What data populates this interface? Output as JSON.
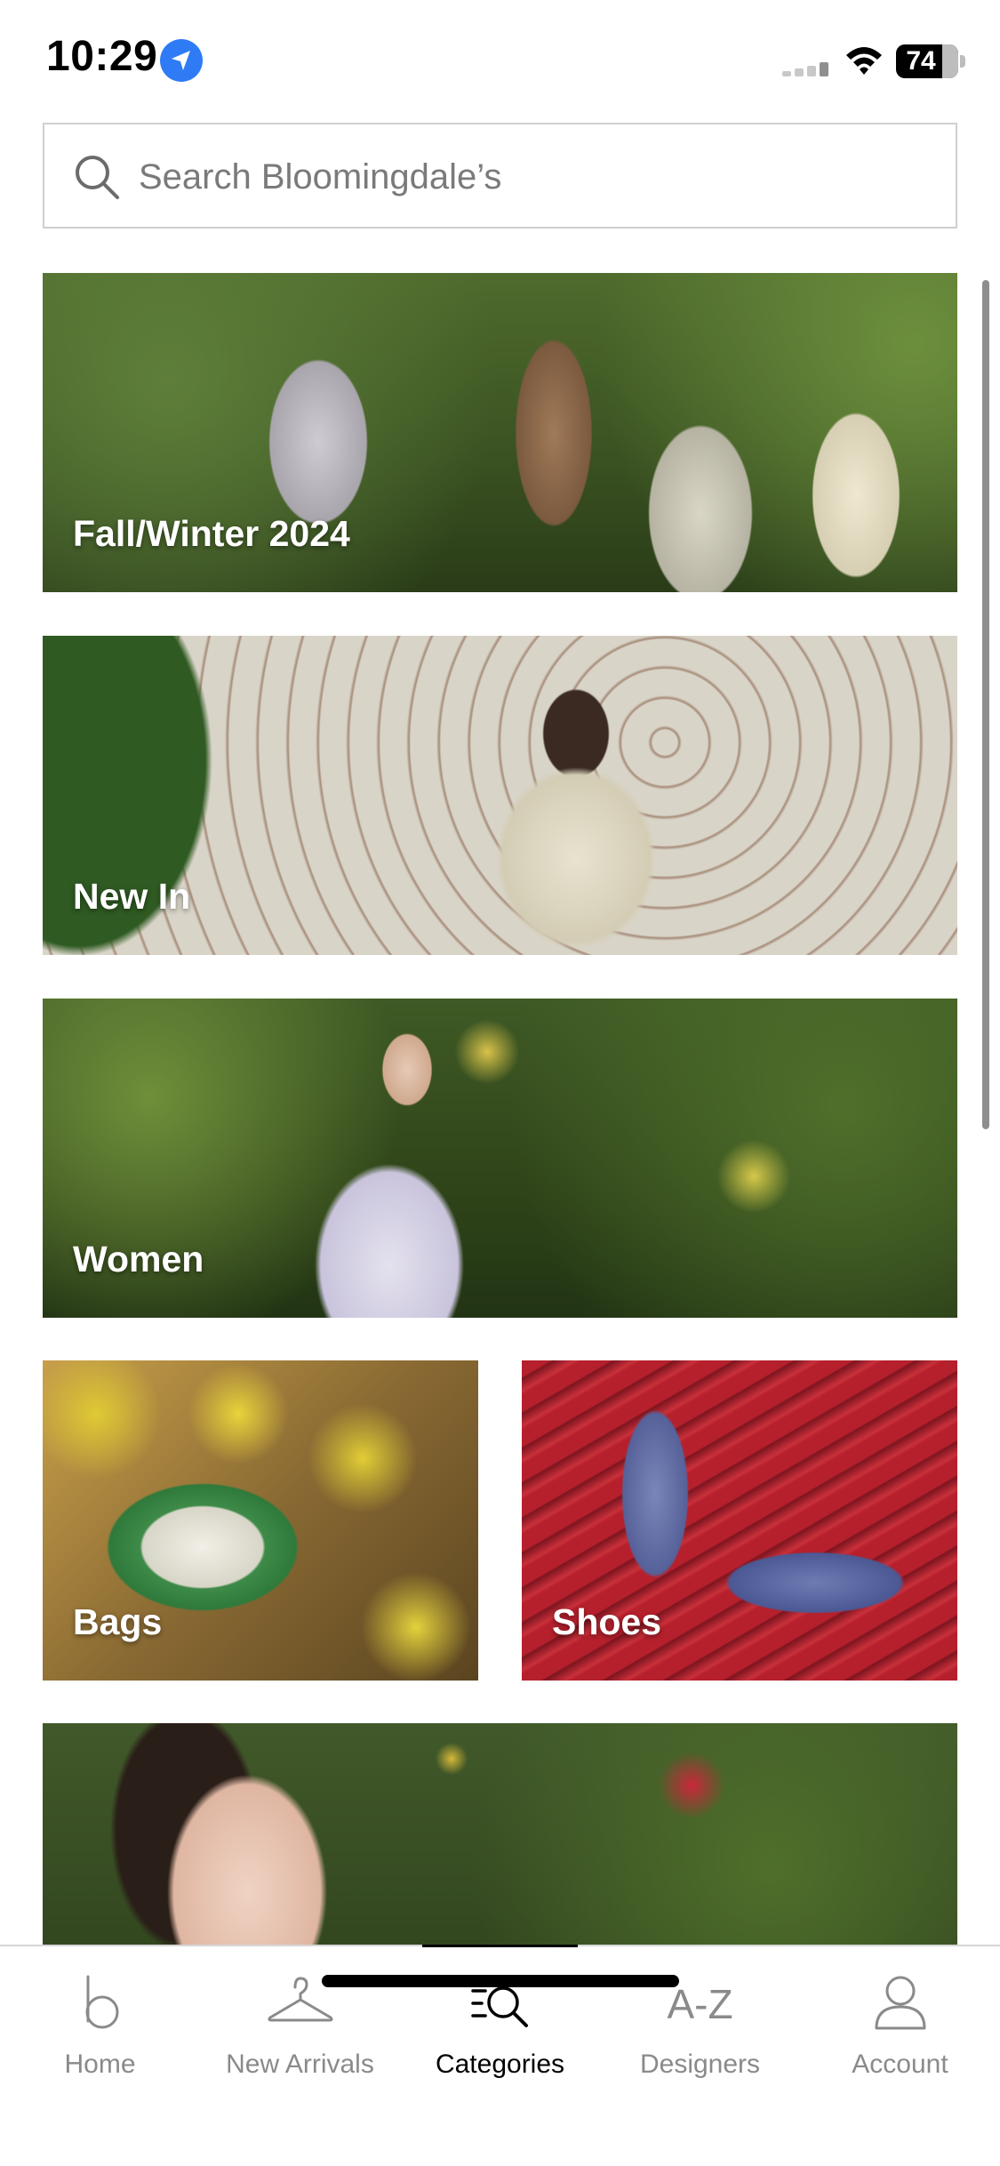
{
  "status_bar": {
    "time": "10:29",
    "battery_level": "74",
    "icons": [
      "location-arrow-icon",
      "cellular-signal-icon",
      "wifi-icon",
      "battery-icon"
    ]
  },
  "search": {
    "placeholder": "Search Bloomingdale’s",
    "value": "",
    "icon": "search-icon"
  },
  "categories": [
    {
      "label": "Fall/Winter 2024"
    },
    {
      "label": "New In"
    },
    {
      "label": "Women"
    },
    {
      "label": "Bags"
    },
    {
      "label": "Shoes"
    },
    {
      "label": ""
    }
  ],
  "tab_bar": {
    "active": "Categories",
    "tabs": [
      {
        "label": "Home",
        "icon": "home-b-icon"
      },
      {
        "label": "New Arrivals",
        "icon": "hanger-icon"
      },
      {
        "label": "Categories",
        "icon": "categories-search-icon"
      },
      {
        "label": "Designers",
        "icon": "a-z-icon",
        "icon_text": "A-Z"
      },
      {
        "label": "Account",
        "icon": "account-person-icon"
      }
    ]
  },
  "colors": {
    "location_badge": "#2f7bf5",
    "tab_inactive": "#8a8a8a",
    "tab_active": "#000000",
    "search_border": "#cfcfcf"
  }
}
